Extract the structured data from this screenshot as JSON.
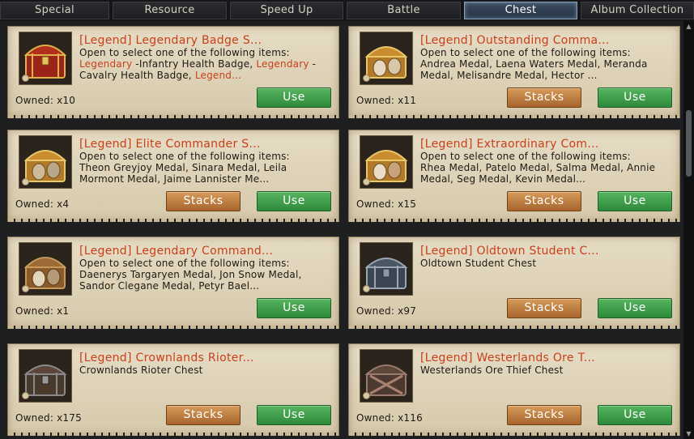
{
  "tabs": [
    {
      "label": "Special"
    },
    {
      "label": "Resource"
    },
    {
      "label": "Speed Up"
    },
    {
      "label": "Battle"
    },
    {
      "label": "Chest",
      "active": true
    },
    {
      "label": "Album Collection"
    }
  ],
  "buttons": {
    "use": "Use",
    "stacks": "Stacks"
  },
  "colors": {
    "accent": "#c8401a",
    "use_green": "#3a9a47",
    "stacks_orange": "#c07a3c",
    "active_tab": "#8aa2bd"
  },
  "items": [
    {
      "title": "[Legend] Legendary Badge S...",
      "desc_intro": "Open to select one of the following items:",
      "desc_parts": [
        "Legendary",
        " -Infantry Health Badge, ",
        "Legendary",
        " - Cavalry Health Badge, ",
        "Legend..."
      ],
      "owned": "Owned: x10",
      "icon": "red-chest-icon"
    },
    {
      "title": "[Legend] Outstanding Comma...",
      "desc_intro": "Open to select one of the following items:",
      "desc_text": "Andrea Medal, Laena Waters Medal, Meranda Medal, Melisandre Medal, Hector ...",
      "owned": "Owned: x11",
      "icon": "gold-commander-chest-icon"
    },
    {
      "title": "[Legend] Elite Commander S...",
      "desc_intro": "Open to select one of the following items:",
      "desc_text": "Theon Greyjoy Medal, Sinara Medal, Leila Mormont Medal, Jaime Lannister Me...",
      "owned": "Owned: x4",
      "icon": "gold-commander-chest-icon"
    },
    {
      "title": "[Legend] Extraordinary Com...",
      "desc_intro": "Open to select one of the following items:",
      "desc_text": "Rhea Medal, Patelo Medal, Salma Medal, Annie Medal, Seg Medal, Kevin Medal...",
      "owned": "Owned: x15",
      "icon": "gold-commander-chest-icon"
    },
    {
      "title": "[Legend] Legendary Command...",
      "desc_intro": "Open to select one of the following items:",
      "desc_text": "Daenerys Targaryen Medal, Jon Snow Medal, Sandor Clegane Medal, Petyr Bael...",
      "owned": "Owned: x1",
      "icon": "bronze-commander-chest-icon"
    },
    {
      "title": "[Legend] Oldtown Student C...",
      "desc_text": "Oldtown Student Chest",
      "owned": "Owned: x97",
      "icon": "steel-chest-icon"
    },
    {
      "title": "[Legend] Crownlands Rioter...",
      "desc_text": "Crownlands Rioter Chest",
      "owned": "Owned: x175",
      "icon": "iron-chest-icon"
    },
    {
      "title": "[Legend] Westerlands Ore T...",
      "desc_text": "Westerlands Ore Thief Chest",
      "owned": "Owned: x116",
      "icon": "crossed-chest-icon"
    }
  ]
}
